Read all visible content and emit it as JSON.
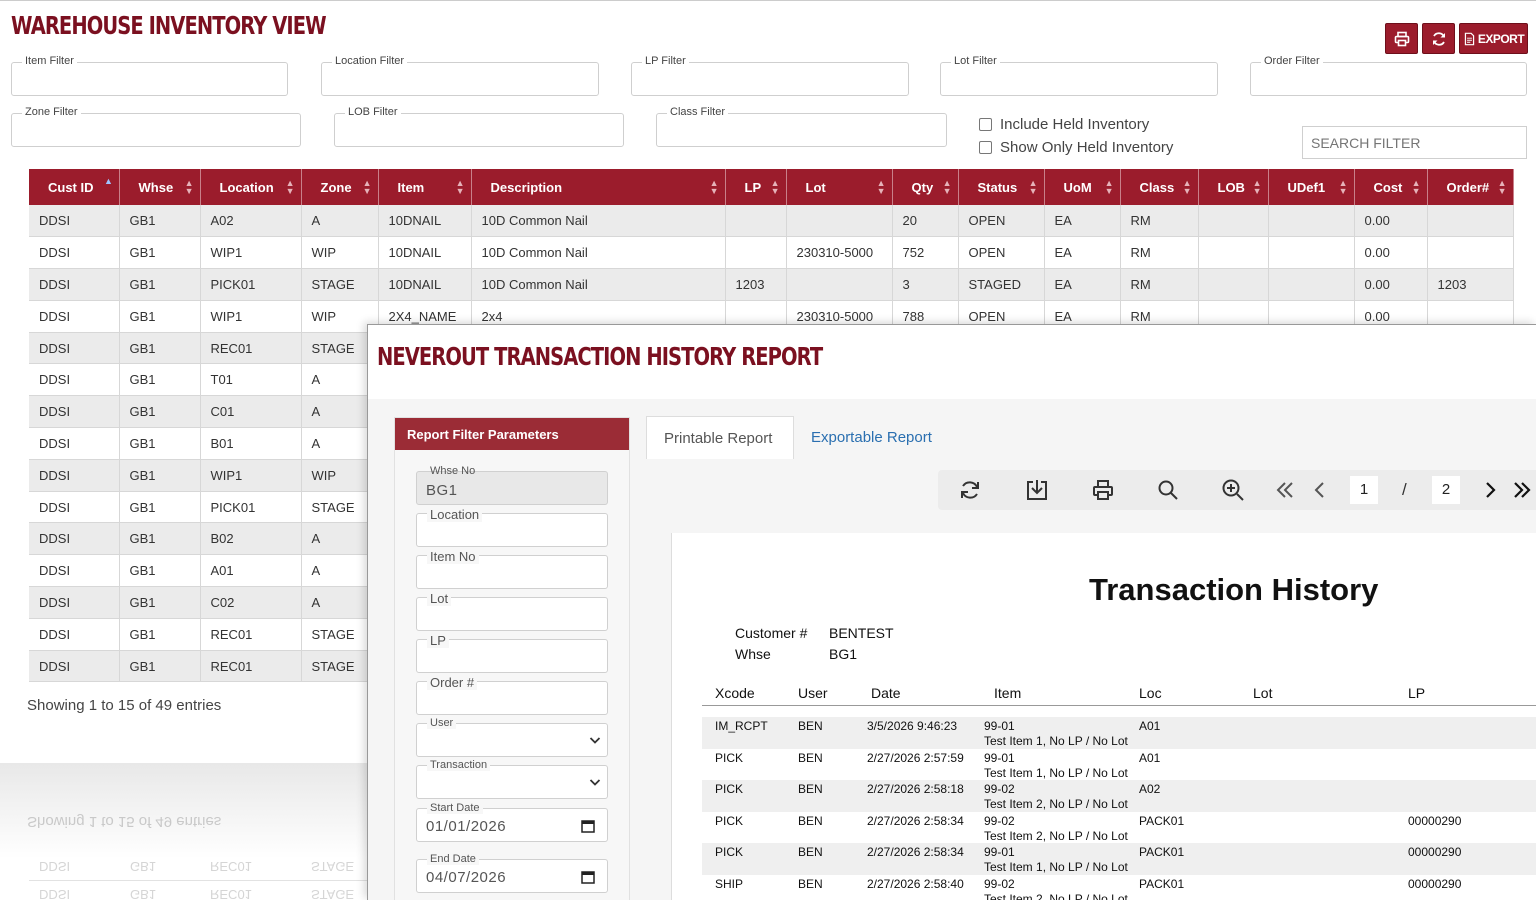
{
  "inventory": {
    "title": "WAREHOUSE INVENTORY VIEW",
    "export_label": "EXPORT",
    "filters": {
      "item": "Item Filter",
      "location": "Location Filter",
      "lp": "LP Filter",
      "lot": "Lot Filter",
      "order": "Order Filter",
      "zone": "Zone Filter",
      "lob": "LOB Filter",
      "class": "Class Filter"
    },
    "include_held": "Include Held Inventory",
    "show_only_held": "Show Only Held Inventory",
    "search_placeholder": "SEARCH FILTER",
    "columns": [
      "Cust ID",
      "Whse",
      "Location",
      "Zone",
      "Item",
      "Description",
      "LP",
      "Lot",
      "Qty",
      "Status",
      "UoM",
      "Class",
      "LOB",
      "UDef1",
      "Cost",
      "Order#"
    ],
    "rows": [
      [
        "DDSI",
        "GB1",
        "A02",
        "A",
        "10DNAIL",
        "10D Common Nail",
        "",
        "",
        "20",
        "OPEN",
        "EA",
        "RM",
        "",
        "",
        "0.00",
        ""
      ],
      [
        "DDSI",
        "GB1",
        "WIP1",
        "WIP",
        "10DNAIL",
        "10D Common Nail",
        "",
        "230310-5000",
        "752",
        "OPEN",
        "EA",
        "RM",
        "",
        "",
        "0.00",
        ""
      ],
      [
        "DDSI",
        "GB1",
        "PICK01",
        "STAGE",
        "10DNAIL",
        "10D Common Nail",
        "1203",
        "",
        "3",
        "STAGED",
        "EA",
        "RM",
        "",
        "",
        "0.00",
        "1203"
      ],
      [
        "DDSI",
        "GB1",
        "WIP1",
        "WIP",
        "2X4_NAME",
        "2x4",
        "",
        "230310-5000",
        "788",
        "OPEN",
        "EA",
        "RM",
        "",
        "",
        "0.00",
        ""
      ],
      [
        "DDSI",
        "GB1",
        "REC01",
        "STAGE",
        "",
        "",
        "",
        "",
        "",
        "",
        "",
        "",
        "",
        "",
        "",
        ""
      ],
      [
        "DDSI",
        "GB1",
        "T01",
        "A",
        "",
        "",
        "",
        "",
        "",
        "",
        "",
        "",
        "",
        "",
        "",
        ""
      ],
      [
        "DDSI",
        "GB1",
        "C01",
        "A",
        "",
        "",
        "",
        "",
        "",
        "",
        "",
        "",
        "",
        "",
        "",
        ""
      ],
      [
        "DDSI",
        "GB1",
        "B01",
        "A",
        "",
        "",
        "",
        "",
        "",
        "",
        "",
        "",
        "",
        "",
        "",
        ""
      ],
      [
        "DDSI",
        "GB1",
        "WIP1",
        "WIP",
        "",
        "",
        "",
        "",
        "",
        "",
        "",
        "",
        "",
        "",
        "",
        ""
      ],
      [
        "DDSI",
        "GB1",
        "PICK01",
        "STAGE",
        "",
        "",
        "",
        "",
        "",
        "",
        "",
        "",
        "",
        "",
        "",
        ""
      ],
      [
        "DDSI",
        "GB1",
        "B02",
        "A",
        "",
        "",
        "",
        "",
        "",
        "",
        "",
        "",
        "",
        "",
        "",
        ""
      ],
      [
        "DDSI",
        "GB1",
        "A01",
        "A",
        "",
        "",
        "",
        "",
        "",
        "",
        "",
        "",
        "",
        "",
        "",
        ""
      ],
      [
        "DDSI",
        "GB1",
        "C02",
        "A",
        "",
        "",
        "",
        "",
        "",
        "",
        "",
        "",
        "",
        "",
        "",
        ""
      ],
      [
        "DDSI",
        "GB1",
        "REC01",
        "STAGE",
        "",
        "",
        "",
        "",
        "",
        "",
        "",
        "",
        "",
        "",
        "",
        ""
      ],
      [
        "DDSI",
        "GB1",
        "REC01",
        "STAGE",
        "",
        "",
        "",
        "",
        "",
        "",
        "",
        "",
        "",
        "",
        "",
        ""
      ]
    ],
    "showing": "Showing 1 to 15 of 49 entries"
  },
  "reflection": {
    "showing": "Showing 1 to 15 of 49 entries",
    "rows": [
      [
        "DDSI",
        "GB1",
        "REC01",
        "STAGE"
      ],
      [
        "DDSI",
        "GB1",
        "REC01",
        "STAGE"
      ]
    ]
  },
  "report": {
    "title": "NEVEROUT TRANSACTION HISTORY REPORT",
    "panel_title": "Report Filter Parameters",
    "fields": {
      "whse_label": "Whse No",
      "whse_value": "BG1",
      "location_label": "Location",
      "item_label": "Item No",
      "lot_label": "Lot",
      "lp_label": "LP",
      "order_label": "Order #",
      "user_label": "User",
      "transaction_label": "Transaction",
      "start_label": "Start Date",
      "start_value": "01/01/2026",
      "end_label": "End Date",
      "end_value": "04/07/2026"
    },
    "tabs": {
      "printable": "Printable Report",
      "exportable": "Exportable Report"
    },
    "pager": {
      "current": "1",
      "sep": "/",
      "total": "2"
    },
    "doc": {
      "title": "Transaction History",
      "customer_label": "Customer #",
      "customer_value": "BENTEST",
      "whse_label": "Whse",
      "whse_value": "BG1",
      "columns": [
        "Xcode",
        "User",
        "Date",
        "Item",
        "Loc",
        "Lot",
        "LP"
      ],
      "rows": [
        {
          "xcode": "IM_RCPT",
          "user": "BEN",
          "date": "3/5/2026 9:46:23",
          "item": "99-01",
          "desc": "Test Item 1, No LP / No Lot",
          "loc": "A01",
          "lp": ""
        },
        {
          "xcode": "PICK",
          "user": "BEN",
          "date": "2/27/2026 2:57:59",
          "item": "99-01",
          "desc": "Test Item 1, No LP / No Lot",
          "loc": "A01",
          "lp": ""
        },
        {
          "xcode": "PICK",
          "user": "BEN",
          "date": "2/27/2026 2:58:18",
          "item": "99-02",
          "desc": "Test Item 2, No LP / No Lot",
          "loc": "A02",
          "lp": ""
        },
        {
          "xcode": "PICK",
          "user": "BEN",
          "date": "2/27/2026 2:58:34",
          "item": "99-02",
          "desc": "Test Item 2, No LP / No Lot",
          "loc": "PACK01",
          "lp": "00000290"
        },
        {
          "xcode": "PICK",
          "user": "BEN",
          "date": "2/27/2026 2:58:34",
          "item": "99-01",
          "desc": "Test Item 1, No LP / No Lot",
          "loc": "PACK01",
          "lp": "00000290"
        },
        {
          "xcode": "SHIP",
          "user": "BEN",
          "date": "2/27/2026 2:58:40",
          "item": "99-02",
          "desc": "Test Item 2, No LP / No Lot",
          "loc": "PACK01",
          "lp": "00000290"
        }
      ]
    }
  },
  "colors": {
    "brand": "#9b1c2c",
    "title": "#7b1020",
    "link": "#2a6fb0"
  }
}
